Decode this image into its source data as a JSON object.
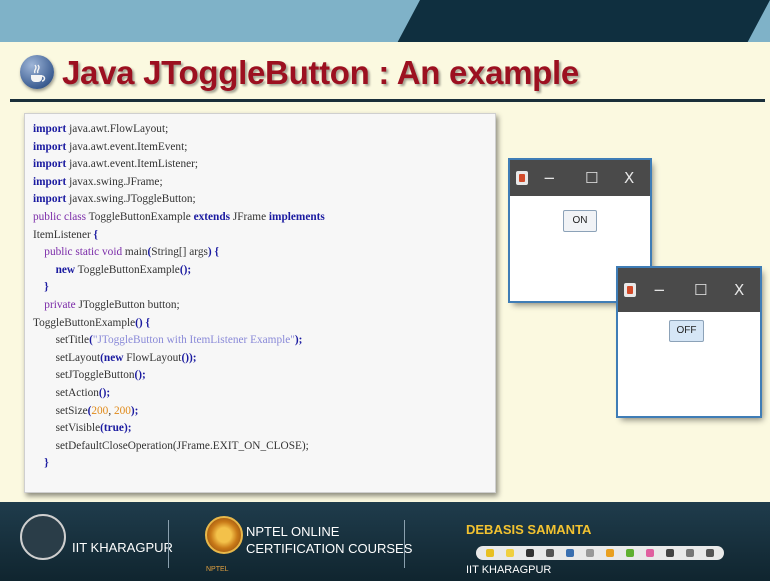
{
  "slide": {
    "title": "Java JToggleButton : An example",
    "code_lines": [
      [
        {
          "t": "import",
          "c": "kw"
        },
        {
          "t": " java.awt.FlowLayout;"
        }
      ],
      [
        {
          "t": "import",
          "c": "kw"
        },
        {
          "t": " java.awt.event.ItemEvent;"
        }
      ],
      [
        {
          "t": "import",
          "c": "kw"
        },
        {
          "t": " java.awt.event.ItemListener;"
        }
      ],
      [
        {
          "t": "import",
          "c": "kw"
        },
        {
          "t": " javax.swing.JFrame;"
        }
      ],
      [
        {
          "t": "import",
          "c": "kw"
        },
        {
          "t": " javax.swing.JToggleButton;"
        }
      ],
      [
        {
          "t": "public class",
          "c": "kl"
        },
        {
          "t": " ToggleButtonExample "
        },
        {
          "t": "extends",
          "c": "kw"
        },
        {
          "t": " JFrame "
        },
        {
          "t": "implements",
          "c": "kw"
        }
      ],
      [
        {
          "t": "ItemListener "
        },
        {
          "t": "{",
          "c": "kw"
        }
      ],
      [
        {
          "t": "    "
        },
        {
          "t": "public static void",
          "c": "kl"
        },
        {
          "t": " main"
        },
        {
          "t": "(",
          "c": "kw"
        },
        {
          "t": "String[] args"
        },
        {
          "t": ")",
          "c": "kw"
        },
        {
          "t": " "
        },
        {
          "t": "{",
          "c": "kw"
        }
      ],
      [
        {
          "t": "        "
        },
        {
          "t": "new",
          "c": "kw"
        },
        {
          "t": " ToggleButtonExample"
        },
        {
          "t": "();",
          "c": "kw"
        }
      ],
      [
        {
          "t": "    "
        },
        {
          "t": "}",
          "c": "kw"
        }
      ],
      [
        {
          "t": "    "
        },
        {
          "t": "private",
          "c": "kl"
        },
        {
          "t": " JToggleButton button;"
        }
      ],
      [
        {
          "t": "ToggleButtonExample"
        },
        {
          "t": "()",
          "c": "kw"
        },
        {
          "t": " "
        },
        {
          "t": "{",
          "c": "kw"
        }
      ],
      [
        {
          "t": "        setTitle"
        },
        {
          "t": "(",
          "c": "kw"
        },
        {
          "t": "\"JToggleButton with ItemListener Example\"",
          "c": "st"
        },
        {
          "t": ");",
          "c": "kw"
        }
      ],
      [
        {
          "t": "        setLayout"
        },
        {
          "t": "(new",
          "c": "kw"
        },
        {
          "t": " FlowLayout"
        },
        {
          "t": "());",
          "c": "kw"
        }
      ],
      [
        {
          "t": "        setJToggleButton"
        },
        {
          "t": "();",
          "c": "kw"
        }
      ],
      [
        {
          "t": "        setAction"
        },
        {
          "t": "();",
          "c": "kw"
        }
      ],
      [
        {
          "t": "        setSize"
        },
        {
          "t": "(",
          "c": "kw"
        },
        {
          "t": "200",
          "c": "nm"
        },
        {
          "t": ", "
        },
        {
          "t": "200",
          "c": "nm"
        },
        {
          "t": ");",
          "c": "kw"
        }
      ],
      [
        {
          "t": "        setVisible"
        },
        {
          "t": "(true);",
          "c": "kw"
        }
      ],
      [
        {
          "t": "        setDefaultCloseOperation(JFrame.EXIT_ON_CLOSE);"
        }
      ],
      [
        {
          "t": "    "
        },
        {
          "t": "}",
          "c": "kw"
        }
      ]
    ],
    "windows": [
      {
        "minimize": "−",
        "maximize": "☐",
        "close": "X",
        "button_label": "ON",
        "button_state": "off"
      },
      {
        "minimize": "−",
        "maximize": "☐",
        "close": "X",
        "button_label": "OFF",
        "button_state": "pressed"
      }
    ]
  },
  "footer": {
    "institute": "IIT KHARAGPUR",
    "nptel_line1": "NPTEL ONLINE",
    "nptel_line2": "CERTIFICATION COURSES",
    "nptel_small": "NPTEL",
    "presenter_name": "DEBASIS SAMANTA",
    "presenter_affiliation": "IIT KHARAGPUR"
  },
  "colors": {
    "title": "#9c1020",
    "keyword": "#1a1aa0",
    "string": "#8a8ad8",
    "number": "#e08a1a",
    "presenter_name": "#f2c230",
    "window_border": "#3f7db6"
  },
  "icons": {
    "slide_logo": "java-cup-icon",
    "footer_left": "iit-kharagpur-emblem-icon",
    "footer_mid": "nptel-logo-icon",
    "window": "java-app-icon",
    "toolbar": "annotation-toolbar-icons"
  }
}
